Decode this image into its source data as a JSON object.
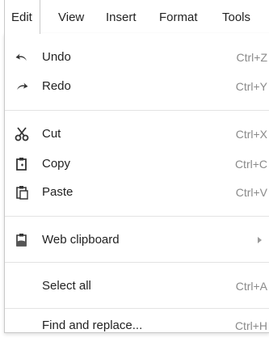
{
  "menubar": {
    "items": [
      {
        "label": "Edit"
      },
      {
        "label": "View"
      },
      {
        "label": "Insert"
      },
      {
        "label": "Format"
      },
      {
        "label": "Tools"
      }
    ]
  },
  "edit_menu": {
    "undo": {
      "label": "Undo",
      "shortcut": "Ctrl+Z",
      "icon": "undo-icon"
    },
    "redo": {
      "label": "Redo",
      "shortcut": "Ctrl+Y",
      "icon": "redo-icon"
    },
    "cut": {
      "label": "Cut",
      "shortcut": "Ctrl+X",
      "icon": "scissors-icon"
    },
    "copy": {
      "label": "Copy",
      "shortcut": "Ctrl+C",
      "icon": "copy-icon"
    },
    "paste": {
      "label": "Paste",
      "shortcut": "Ctrl+V",
      "icon": "paste-icon"
    },
    "web_clipboard": {
      "label": "Web clipboard",
      "icon": "clipboard-icon"
    },
    "select_all": {
      "label": "Select all",
      "shortcut": "Ctrl+A"
    },
    "find_replace": {
      "label": "Find and replace...",
      "shortcut": "Ctrl+H"
    }
  },
  "colors": {
    "text": "#222222",
    "shortcut_text": "#8a8a8a",
    "border": "#c8c8c8",
    "separator": "#e3e3e3"
  }
}
